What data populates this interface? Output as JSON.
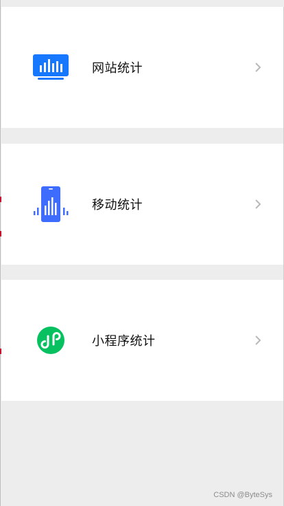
{
  "colors": {
    "background": "#ededed",
    "card": "#ffffff",
    "website_icon": "#1677ff",
    "mobile_icon": "#3d6cff",
    "miniprogram_icon": "#07c160",
    "chevron": "#b8b8b8",
    "watermark": "#8b8b8b"
  },
  "items": [
    {
      "label": "网站统计",
      "icon": "website-stats-icon"
    },
    {
      "label": "移动统计",
      "icon": "mobile-stats-icon"
    },
    {
      "label": "小程序统计",
      "icon": "mini-program-icon"
    }
  ],
  "watermark": "CSDN @ByteSys"
}
